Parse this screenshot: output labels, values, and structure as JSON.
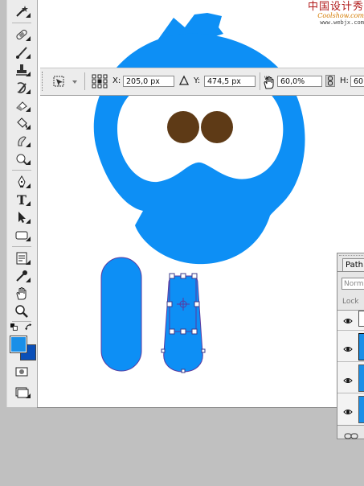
{
  "options_bar": {
    "x_label": "X:",
    "x_value": "205,0 px",
    "y_label": "Y:",
    "y_value": "474,5 px",
    "w_value": "60,0%",
    "h_label": "H:",
    "h_value": "60"
  },
  "layers_panel": {
    "tab_label": "Path",
    "blend_mode": "Norm",
    "lock_label": "Lock"
  },
  "watermark": {
    "line1": "中国设计秀",
    "line2": "Coolshow.com",
    "line3": "www.webjx.com"
  },
  "colors": {
    "foreground": "#1a8fe8",
    "background": "#0a4fb8",
    "bird_blue": "#0d8ff5",
    "eye_brown": "#5e3a16",
    "path_outline": "#5a3aa0"
  }
}
